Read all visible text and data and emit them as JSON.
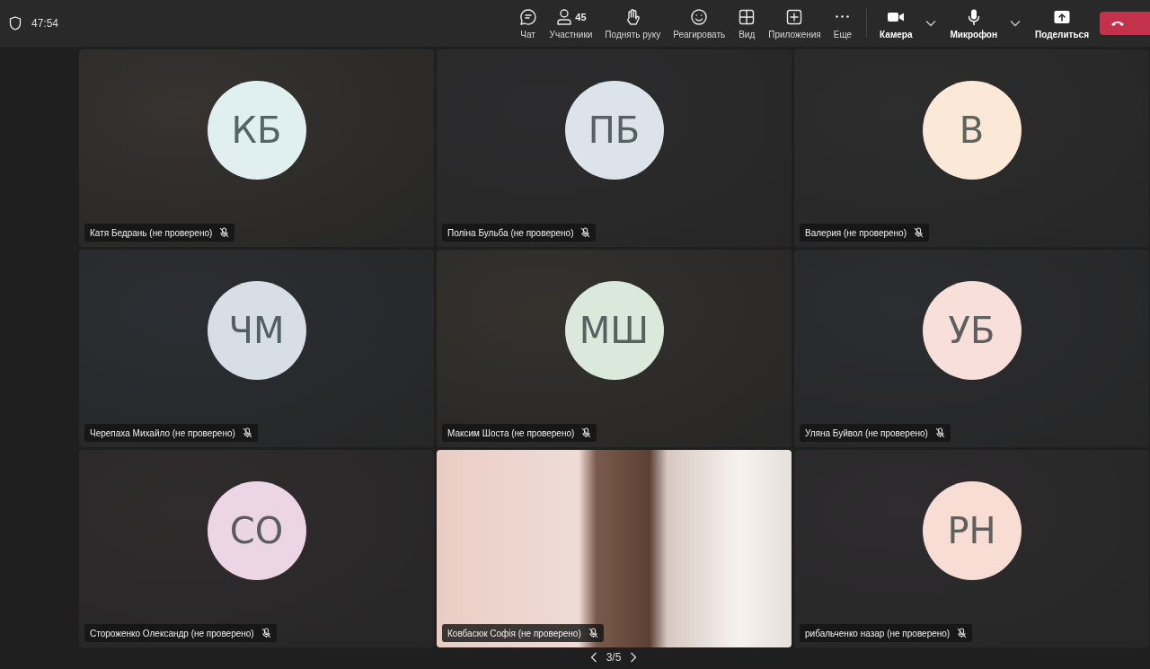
{
  "toolbar": {
    "timer": "47:54",
    "participants_count": "45",
    "actions": [
      {
        "kind": "chat",
        "label": "Чат"
      },
      {
        "kind": "people",
        "label": "Участники"
      },
      {
        "kind": "hand",
        "label": "Поднять руку"
      },
      {
        "kind": "react",
        "label": "Реагировать"
      },
      {
        "kind": "view",
        "label": "Вид"
      },
      {
        "kind": "apps",
        "label": "Приложения"
      },
      {
        "kind": "more",
        "label": "Еще"
      }
    ],
    "devices": [
      {
        "kind": "camera",
        "label": "Камера"
      },
      {
        "kind": "mic",
        "label": "Микрофон"
      },
      {
        "kind": "share",
        "label": "Поделиться"
      }
    ]
  },
  "tile_rows": [
    {
      "tiles": [
        {
          "kind": "avatar",
          "initials": "КБ",
          "color": "#e0f0f0",
          "name": "Катя Бедрань (не проверено)",
          "muted": true
        },
        {
          "kind": "avatar",
          "initials": "ПБ",
          "color": "#dde3ea",
          "name": "Поліна Бульба (не проверено)",
          "muted": true
        },
        {
          "kind": "avatar",
          "initials": "В",
          "color": "#fbe8d6",
          "name": "Валерия (не проверено)",
          "muted": true
        }
      ]
    },
    {
      "tiles": [
        {
          "kind": "avatar",
          "initials": "ЧМ",
          "color": "#d8dee6",
          "name": "Черепаха Михайло (не проверено)",
          "muted": true
        },
        {
          "kind": "avatar",
          "initials": "МШ",
          "color": "#dbe8dc",
          "name": "Максим Шоста (не проверено)",
          "muted": true
        },
        {
          "kind": "avatar",
          "initials": "УБ",
          "color": "#f8dfd9",
          "name": "Уляна Буйвол (не проверено)",
          "muted": true
        }
      ]
    },
    {
      "tiles": [
        {
          "kind": "avatar",
          "initials": "СО",
          "color": "#ecd5e4",
          "name": "Стороженко Олександр (не проверено)",
          "muted": true
        },
        {
          "kind": "video",
          "name": "Ковбасюк Софія (не проверено)",
          "muted": true
        },
        {
          "kind": "avatar",
          "initials": "РН",
          "color": "#f8ddd5",
          "name": "рибальченко назар (не проверено)",
          "muted": true
        }
      ]
    }
  ],
  "pager": {
    "text": "3/5"
  }
}
